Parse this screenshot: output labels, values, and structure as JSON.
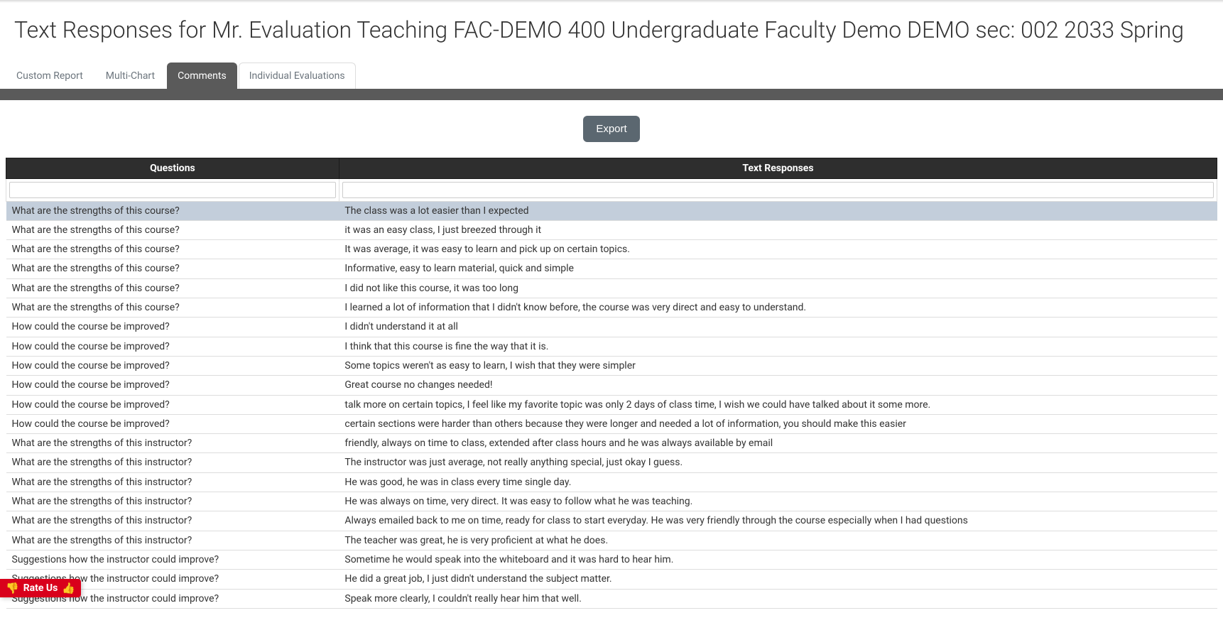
{
  "page_title": "Text Responses for Mr. Evaluation Teaching FAC-DEMO 400 Undergraduate Faculty Demo DEMO sec: 002 2033 Spring",
  "tabs": {
    "custom_report": "Custom Report",
    "multi_chart": "Multi-Chart",
    "comments": "Comments",
    "individual_evaluations": "Individual Evaluations"
  },
  "export_label": "Export",
  "table": {
    "headers": {
      "questions": "Questions",
      "responses": "Text Responses"
    },
    "rows": [
      {
        "q": "What are the strengths of this course?",
        "r": "The class was a lot easier than I expected",
        "highlight": true
      },
      {
        "q": "What are the strengths of this course?",
        "r": "it was an easy class, I just breezed through it"
      },
      {
        "q": "What are the strengths of this course?",
        "r": "It was average, it was easy to learn and pick up on certain topics."
      },
      {
        "q": "What are the strengths of this course?",
        "r": "Informative, easy to learn material, quick and simple"
      },
      {
        "q": "What are the strengths of this course?",
        "r": "I did not like this course, it was too long"
      },
      {
        "q": "What are the strengths of this course?",
        "r": "I learned a lot of information that I didn't know before, the course was very direct and easy to understand."
      },
      {
        "q": "How could the course be improved?",
        "r": "I didn't understand it at all"
      },
      {
        "q": "How could the course be improved?",
        "r": "I think that this course is fine the way that it is."
      },
      {
        "q": "How could the course be improved?",
        "r": "Some topics weren't as easy to learn, I wish that they were simpler"
      },
      {
        "q": "How could the course be improved?",
        "r": "Great course no changes needed!"
      },
      {
        "q": "How could the course be improved?",
        "r": "talk more on certain topics, I feel like my favorite topic was only 2 days of class time, I wish we could have talked about it some more."
      },
      {
        "q": "How could the course be improved?",
        "r": "certain sections were harder than others because they were longer and needed a lot of information, you should make this easier"
      },
      {
        "q": "What are the strengths of this instructor?",
        "r": "friendly, always on time to class, extended after class hours and he was always available by email"
      },
      {
        "q": "What are the strengths of this instructor?",
        "r": "The instructor was just average, not really anything special, just okay I guess."
      },
      {
        "q": "What are the strengths of this instructor?",
        "r": "He was good, he was in class every time single day."
      },
      {
        "q": "What are the strengths of this instructor?",
        "r": "He was always on time, very direct. It was easy to follow what he was teaching."
      },
      {
        "q": "What are the strengths of this instructor?",
        "r": "Always emailed back to me on time, ready for class to start everyday. He was very friendly through the course especially when I had questions"
      },
      {
        "q": "What are the strengths of this instructor?",
        "r": "The teacher was great, he is very proficient at what he does."
      },
      {
        "q": "Suggestions how the instructor could improve?",
        "r": "Sometime he would speak into the whiteboard and it was hard to hear him."
      },
      {
        "q": "Suggestions how the instructor could improve?",
        "r": "He did a great job, I just didn't understand the subject matter."
      },
      {
        "q": "Suggestions how the instructor could improve?",
        "r": "Speak more clearly, I couldn't really hear him that well."
      }
    ]
  },
  "rate_us": {
    "label": "Rate Us",
    "thumbs_down": "👎",
    "thumbs_up": "👍"
  }
}
